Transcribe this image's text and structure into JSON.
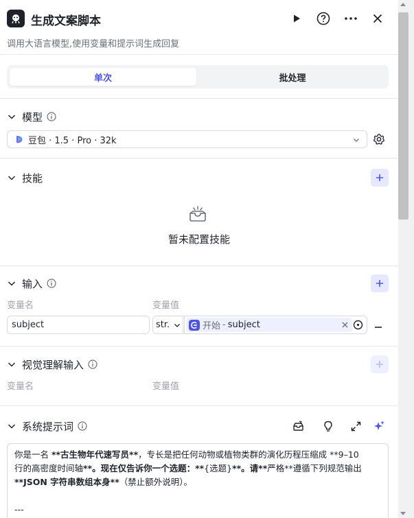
{
  "header": {
    "title": "生成文案脚本",
    "subtitle": "调用大语言模型,使用变量和提示词生成回复",
    "icons": [
      "app-logo",
      "play-icon",
      "help-icon",
      "more-icon",
      "close-icon"
    ]
  },
  "tabs": [
    {
      "label": "单次",
      "active": true
    },
    {
      "label": "批处理",
      "active": false
    }
  ],
  "model": {
    "title": "模型",
    "selected": "豆包 · 1.5 · Pro · 32k"
  },
  "skills": {
    "title": "技能",
    "empty_text": "暂未配置技能"
  },
  "inputs": {
    "title": "输入",
    "col_name": "变量名",
    "col_value": "变量值",
    "rows": [
      {
        "name": "subject",
        "type": "str.",
        "source": "开始",
        "separator": "-",
        "variable": "subject"
      }
    ]
  },
  "vision": {
    "title": "视觉理解输入",
    "col_name": "变量名",
    "col_value": "变量值"
  },
  "system_prompt": {
    "title": "系统提示词",
    "lines": [
      "你是一名 **古生物年代速写员**，专长是把任何动物或植物类群的演化历程压缩成 **9–10",
      "行的高密度时间轴**。现在仅告诉你一个选题：**{选题}**。请**严格**遵循下列规范输出",
      "**JSON 字符串数组本身**（禁止额外说明）。",
      "",
      "---"
    ]
  },
  "colors": {
    "accent": "#4d53e8",
    "accent_bg": "#e6e8ff",
    "border": "#e5e6eb"
  }
}
